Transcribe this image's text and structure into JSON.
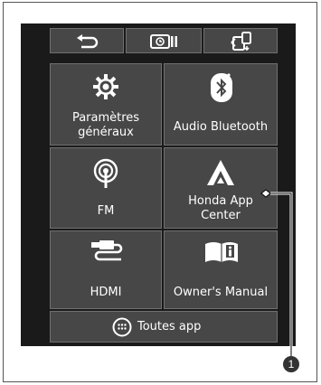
{
  "toolbar": {
    "back_icon": "back-arrow-icon",
    "clock_icon": "clock-settings-icon",
    "switch_icon": "phone-switch-icon"
  },
  "apps": [
    {
      "label": "Paramètres\ngénéraux",
      "icon": "gear-icon"
    },
    {
      "label": "Audio Bluetooth",
      "icon": "bluetooth-icon"
    },
    {
      "label": "FM",
      "icon": "radio-antenna-icon"
    },
    {
      "label": "Honda App\nCenter",
      "icon": "app-center-icon"
    },
    {
      "label": "HDMI",
      "icon": "hdmi-cable-icon"
    },
    {
      "label": "Owner's Manual",
      "icon": "manual-book-icon"
    }
  ],
  "all_apps": {
    "label": "Toutes app",
    "icon": "apps-grid-icon"
  },
  "callout": {
    "number": "1"
  }
}
